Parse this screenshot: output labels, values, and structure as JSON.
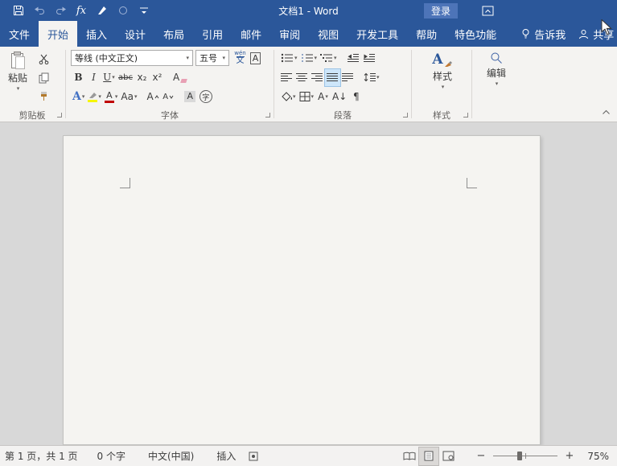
{
  "colors": {
    "accent": "#2B579A",
    "signin_bg": "#4D74B8",
    "highlight_yellow": "#F6F600",
    "font_color_red": "#C00000"
  },
  "glyphs": {
    "caret": "▾"
  },
  "titlebar": {
    "title": "文档1 - Word",
    "signin": "登录",
    "fx": "fx"
  },
  "tabs": {
    "file": "文件",
    "home": "开始",
    "insert": "插入",
    "design": "设计",
    "layout": "布局",
    "references": "引用",
    "mailings": "邮件",
    "review": "审阅",
    "view": "视图",
    "developer": "开发工具",
    "help": "帮助",
    "features": "特色功能",
    "tellme": "告诉我",
    "share": "共享"
  },
  "ribbon": {
    "clipboard": {
      "label": "剪贴板",
      "paste": "粘贴"
    },
    "font": {
      "label": "字体",
      "name": "等线 (中文正文)",
      "size": "五号",
      "bold": "B",
      "italic": "I",
      "underline": "U",
      "strike": "abc",
      "subscript": "x₂",
      "superscript": "x²",
      "clear_letter": "A",
      "phonetic_top": "wén",
      "phonetic_bottom": "文",
      "border_letter": "A",
      "effects_letter": "A",
      "color_letter": "A",
      "case_label": "Aa",
      "grow_letter": "A",
      "shrink_letter": "A",
      "shade_letter": "A",
      "enclose_letter": "字"
    },
    "paragraph": {
      "label": "段落",
      "asian_letter": "A",
      "sort_label": "A↓",
      "pilcrow": "¶"
    },
    "styles": {
      "label": "样式",
      "button": "样式"
    },
    "editing": {
      "button": "编辑"
    }
  },
  "statusbar": {
    "page_info": "第 1 页，共 1 页",
    "word_count": "0 个字",
    "language": "中文(中国)",
    "insert_mode": "插入",
    "zoom_out": "−",
    "zoom_in": "+",
    "zoom": "75%"
  }
}
